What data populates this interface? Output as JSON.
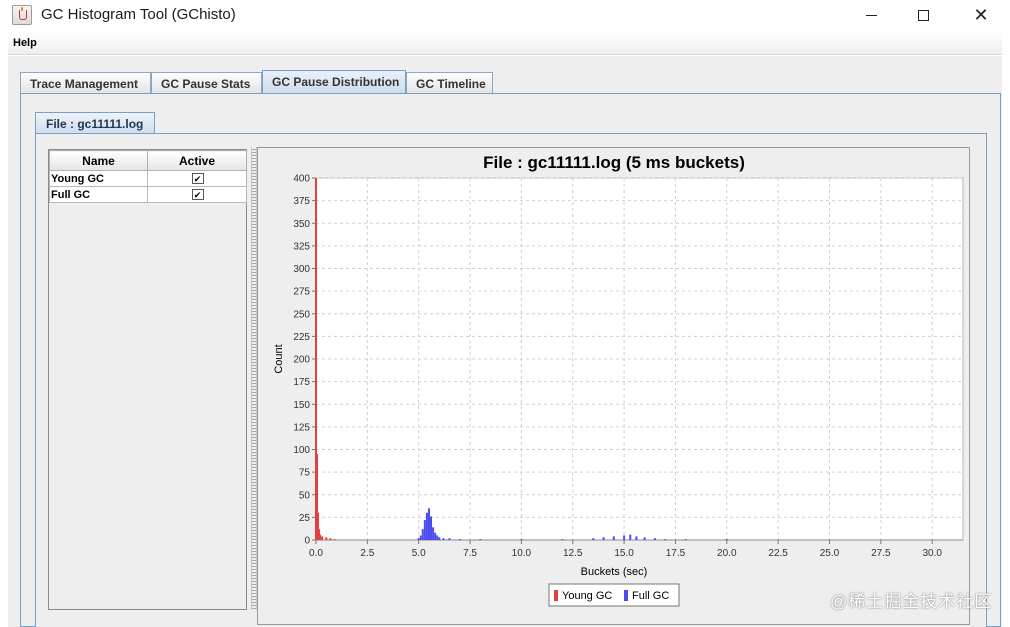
{
  "window": {
    "title": "GC Histogram Tool (GChisto)",
    "minimize_glyph": "",
    "maximize_glyph": "",
    "close_glyph": "✕"
  },
  "menu": {
    "items": [
      "Help"
    ]
  },
  "tabs": [
    {
      "label": "Trace Management",
      "active": false
    },
    {
      "label": "GC Pause Stats",
      "active": false
    },
    {
      "label": "GC Pause Distribution",
      "active": true
    },
    {
      "label": "GC Timeline",
      "active": false
    }
  ],
  "file_tab": {
    "label": "File : gc11111.log"
  },
  "series_table": {
    "headers": [
      "Name",
      "Active"
    ],
    "rows": [
      {
        "name": "Young GC",
        "active": true,
        "check_glyph": "✔"
      },
      {
        "name": "Full GC",
        "active": true,
        "check_glyph": "✔"
      }
    ]
  },
  "colors": {
    "young_gc": "#e04040",
    "full_gc": "#4b4bf0",
    "grid": "#d0d0d0",
    "plot_bg": "#ffffff"
  },
  "chart_data": {
    "type": "bar",
    "title": "File : gc11111.log (5 ms buckets)",
    "xlabel": "Buckets (sec)",
    "ylabel": "Count",
    "xlim": [
      0,
      31.5
    ],
    "ylim": [
      0,
      400
    ],
    "xticks": [
      "0.0",
      "2.5",
      "5.0",
      "7.5",
      "10.0",
      "12.5",
      "15.0",
      "17.5",
      "20.0",
      "22.5",
      "25.0",
      "27.5",
      "30.0"
    ],
    "yticks": [
      "0",
      "25",
      "50",
      "75",
      "100",
      "125",
      "150",
      "175",
      "200",
      "225",
      "250",
      "275",
      "300",
      "325",
      "350",
      "375",
      "400"
    ],
    "grid": true,
    "legend_position": "bottom",
    "series": [
      {
        "name": "Young GC",
        "x": [
          0.0,
          0.05,
          0.1,
          0.15,
          0.2,
          0.3,
          0.5,
          0.7,
          0.9
        ],
        "y": [
          400,
          95,
          30,
          12,
          6,
          4,
          3,
          2,
          1
        ]
      },
      {
        "name": "Full GC",
        "x": [
          5.0,
          5.1,
          5.2,
          5.3,
          5.4,
          5.5,
          5.6,
          5.7,
          5.8,
          5.9,
          6.0,
          6.2,
          6.5,
          7.0,
          8.0,
          10.0,
          12.0,
          13.5,
          14.0,
          14.5,
          15.0,
          15.3,
          15.6,
          16.0,
          16.5,
          17.0,
          18.0,
          20.0,
          25.0
        ],
        "y": [
          2,
          5,
          12,
          22,
          30,
          35,
          26,
          14,
          8,
          5,
          3,
          2,
          2,
          1,
          1,
          1,
          1,
          2,
          3,
          4,
          5,
          6,
          4,
          3,
          2,
          1,
          1,
          1,
          0
        ]
      }
    ]
  }
}
